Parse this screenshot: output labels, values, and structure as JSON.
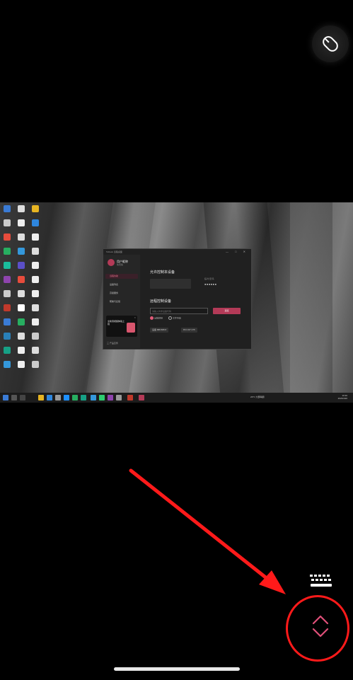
{
  "toolbar": {
    "mouse_mode_icon": "mouse-icon",
    "keyboard_icon": "keyboard-icon",
    "toggle_icon": "chevron-up-down-icon"
  },
  "remote_window": {
    "title": "ToDesk 远程桌面",
    "controls": "— □ ✕",
    "user": {
      "name": "用户昵称",
      "sub": "免费版"
    },
    "nav": [
      {
        "label": "远程协助",
        "active": true
      },
      {
        "label": "设备列表",
        "active": false
      },
      {
        "label": "高级服务",
        "active": false
      },
      {
        "label": "帮助与反馈",
        "active": false
      }
    ],
    "allow_section_title": "允许控制本设备",
    "password_label": "临时密码",
    "password_value": "●●●●●●",
    "remote_section_title": "远程控制设备",
    "partner_placeholder": "请输入伙伴设备代码",
    "connect_button": "连接",
    "radio_options": [
      {
        "label": "远程控制",
        "selected": true
      },
      {
        "label": "文件传输",
        "selected": false
      }
    ],
    "recent_chips": [
      "设备 888 888 8",
      "872 157 475"
    ],
    "ad_title": "全新音视频体验上线",
    "ad_close": "✕",
    "bottom_link": "三 产品宣传"
  },
  "taskbar": {
    "weather": "23°C 大部晴朗",
    "time": "10:30",
    "date": "2023/4/20"
  },
  "colors": {
    "accent": "#b33a57",
    "annotation_red": "#ff1a1a",
    "toggle_pink": "#e0507a"
  }
}
